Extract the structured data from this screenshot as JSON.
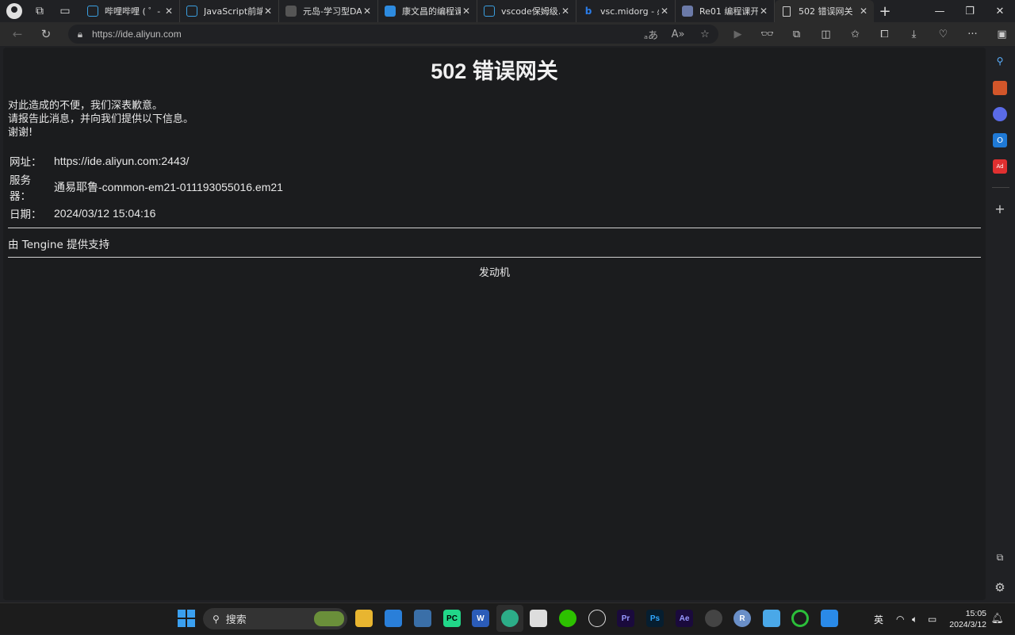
{
  "browser": {
    "tabs": [
      {
        "title": "哔哩哔哩 ( ゜- ゜",
        "favicon": "bilibili-icon",
        "color": "#3a9fe0"
      },
      {
        "title": "JavaScript前端…",
        "favicon": "bilibili-icon",
        "color": "#3a9fe0"
      },
      {
        "title": "元岛-学习型DA…",
        "favicon": "site-icon",
        "color": "#555"
      },
      {
        "title": "康文昌的编程课…",
        "favicon": "site-icon",
        "color": "#2d8be0"
      },
      {
        "title": "vscode保姆级…",
        "favicon": "bilibili-icon",
        "color": "#3a9fe0"
      },
      {
        "title": "vsc.midorg - 必…",
        "favicon": "bing-icon",
        "color": "#2b7de9"
      },
      {
        "title": "Re01 编程课开…",
        "favicon": "site-icon",
        "color": "#6b7aa8"
      },
      {
        "title": "502 错误网关",
        "favicon": "page-icon",
        "color": "transparent"
      }
    ],
    "active_tab_index": 7,
    "url": "https://ide.aliyun.com"
  },
  "page": {
    "heading": "502 错误网关",
    "message_lines": [
      "对此造成的不便，我们深表歉意。",
      "请报告此消息，并向我们提供以下信息。",
      "谢谢!"
    ],
    "details": [
      {
        "key": "网址：",
        "value": "https://ide.aliyun.com:2443/"
      },
      {
        "key": "服务器：",
        "value": "通易耶鲁-common-em21-011193055016.em21"
      },
      {
        "key": "日期：",
        "value": "2024/03/12 15:04:16"
      }
    ],
    "powered_by": "由 Tengine 提供支持",
    "engine_label": "发动机"
  },
  "taskbar": {
    "search_placeholder": "搜索",
    "ime": "英",
    "time": "15:05",
    "date": "2024/3/12"
  },
  "colors": {
    "page_bg": "#1b1c1e",
    "chrome_bg": "#202124",
    "accent": "#3aa0f0"
  }
}
